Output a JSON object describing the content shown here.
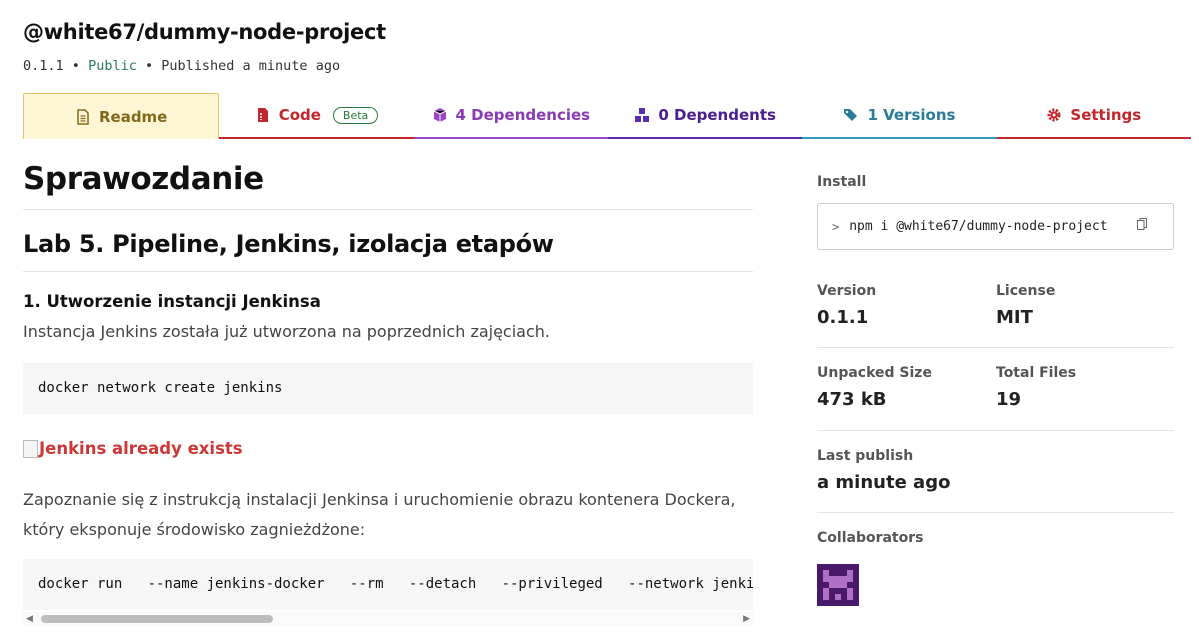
{
  "package": {
    "name": "@white67/dummy-node-project",
    "version": "0.1.1",
    "visibility": "Public",
    "published": "Published a minute ago",
    "separator": "•"
  },
  "tabs": [
    {
      "label": "Readme",
      "icon": "readme-icon"
    },
    {
      "label": "Code",
      "icon": "code-file-icon",
      "badge": "Beta"
    },
    {
      "label": "4 Dependencies",
      "icon": "box-icon"
    },
    {
      "label": "0 Dependents",
      "icon": "boxes-icon"
    },
    {
      "label": "1 Versions",
      "icon": "tags-icon"
    },
    {
      "label": "Settings",
      "icon": "gear-icon"
    }
  ],
  "readme": {
    "h1": "Sprawozdanie",
    "h2": "Lab 5. Pipeline, Jenkins, izolacja etapów",
    "h3": "1. Utworzenie instancji Jenkinsa",
    "p1": "Instancja Jenkins została już utworzona na poprzednich zajęciach.",
    "code1": "docker network create jenkins",
    "image_alt": "Jenkins already exists",
    "p2": "Zapoznanie się z instrukcją instalacji Jenkinsa i uruchomienie obrazu kontenera Dockera, który eksponuje środowisko zagnieżdżone:",
    "code2": "docker run   --name jenkins-docker   --rm   --detach   --privileged   --network jenkins"
  },
  "sidebar": {
    "install_label": "Install",
    "install_command": "npm i @white67/dummy-node-project",
    "version_label": "Version",
    "version_value": "0.1.1",
    "license_label": "License",
    "license_value": "MIT",
    "unpacked_label": "Unpacked Size",
    "unpacked_value": "473 kB",
    "files_label": "Total Files",
    "files_value": "19",
    "last_publish_label": "Last publish",
    "last_publish_value": "a minute ago",
    "collaborators_label": "Collaborators"
  },
  "colors": {
    "code": "#c1272d",
    "dependencies": "#9b45c6",
    "dependents": "#5b2bb0",
    "versions": "#2a9dc0",
    "settings": "#c1272d",
    "readme_bg": "#fff6d6",
    "link": "#cb3837"
  }
}
